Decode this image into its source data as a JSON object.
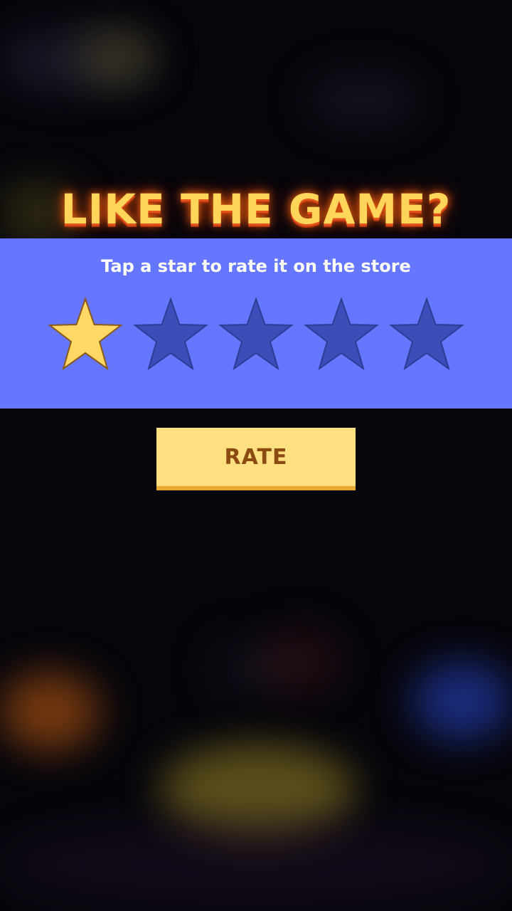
{
  "dialog": {
    "title": "LIKE THE GAME?",
    "subtitle": "Tap a star to rate it on the store",
    "rating": {
      "selected": 1,
      "max": 5
    },
    "rate_button_label": "RATE"
  },
  "colors": {
    "panel": "#6677ff",
    "star_filled": "#ffd866",
    "star_empty": "#3d4db8",
    "button": "#ffe080",
    "button_text": "#8a4a12",
    "title_glow": "#ff6e14"
  },
  "icons": [
    "star-icon"
  ]
}
